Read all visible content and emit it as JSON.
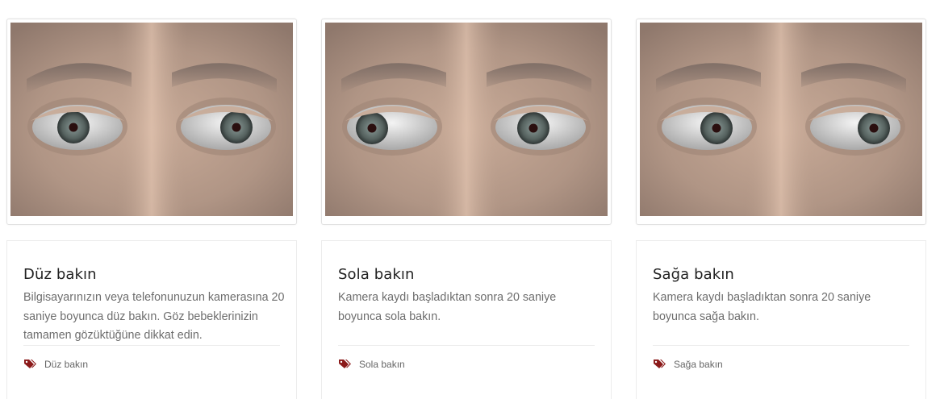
{
  "cards": [
    {
      "image_alt": "Eyes looking straight ahead",
      "title": "Düz bakın",
      "description": "Bilgisayarınızın veya telefonunuzun kamerasına 20 saniye boyunca düz bakın. Göz bebeklerinizin tamamen gözüktüğüne dikkat edin.",
      "tag_icon": "tags-icon",
      "tag": "Düz bakın"
    },
    {
      "image_alt": "Eyes looking left",
      "title": "Sola bakın",
      "description": "Kamera kaydı başladıktan sonra 20 saniye boyunca sola bakın.",
      "tag_icon": "tags-icon",
      "tag": "Sola bakın"
    },
    {
      "image_alt": "Eyes looking right",
      "title": "Sağa bakın",
      "description": "Kamera kaydı başladıktan sonra 20 saniye boyunca sağa bakın.",
      "tag_icon": "tags-icon",
      "tag": "Sağa bakın"
    }
  ],
  "colors": {
    "tag_icon": "#8b1a1a",
    "title": "#222222",
    "text": "#6d6d6d"
  }
}
